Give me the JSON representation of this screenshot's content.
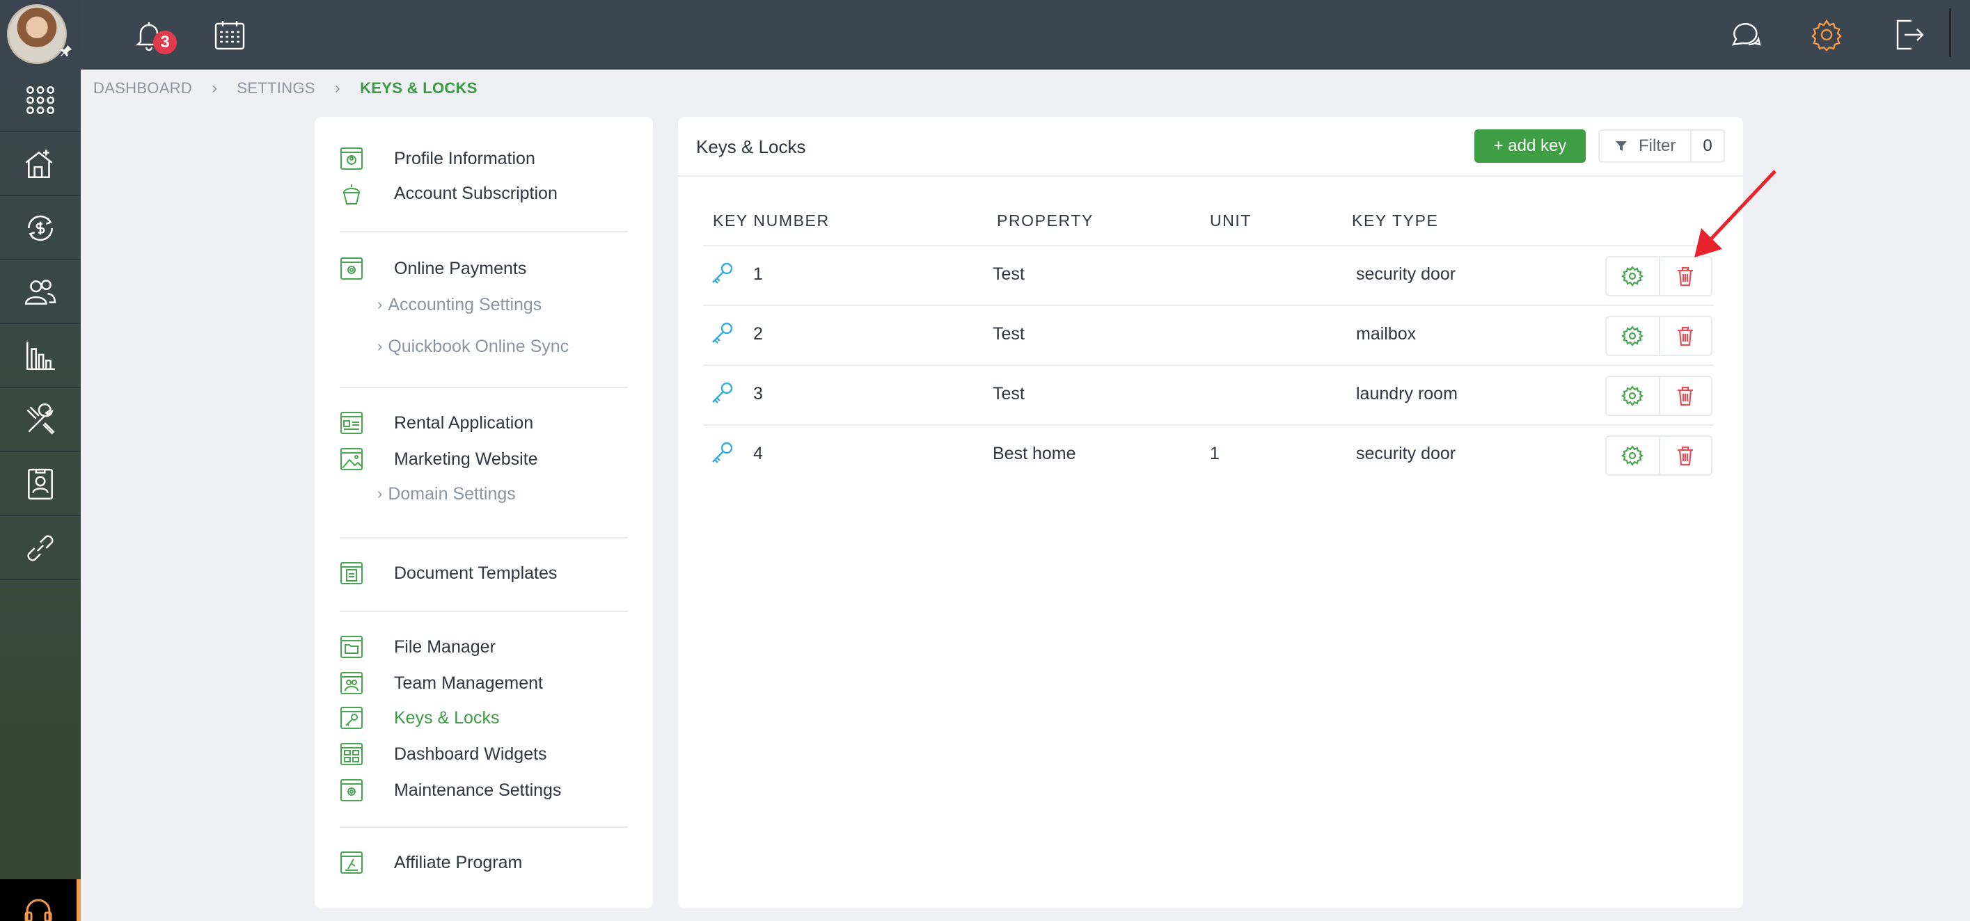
{
  "topbar": {
    "notification_count": "3"
  },
  "breadcrumb": {
    "items": [
      "DASHBOARD",
      "SETTINGS",
      "KEYS & LOCKS"
    ],
    "separator": "›"
  },
  "menu": {
    "profile_information": "Profile Information",
    "account_subscription": "Account Subscription",
    "online_payments": "Online Payments",
    "accounting_settings": "Accounting Settings",
    "quickbook_online_sync": "Quickbook Online Sync",
    "rental_application": "Rental Application",
    "marketing_website": "Marketing Website",
    "domain_settings": "Domain Settings",
    "document_templates": "Document Templates",
    "file_manager": "File Manager",
    "team_management": "Team Management",
    "keys_locks": "Keys & Locks",
    "dashboard_widgets": "Dashboard Widgets",
    "maintenance_settings": "Maintenance Settings",
    "affiliate_program": "Affiliate Program",
    "sub_chevron": "›"
  },
  "card": {
    "title": "Keys & Locks",
    "add_key_label": "+ add key",
    "filter_label": "Filter",
    "filter_count": "0"
  },
  "table": {
    "headers": [
      "KEY NUMBER",
      "PROPERTY",
      "UNIT",
      "KEY TYPE"
    ],
    "rows": [
      {
        "number": "1",
        "property": "Test",
        "unit": "",
        "key_type": "security door"
      },
      {
        "number": "2",
        "property": "Test",
        "unit": "",
        "key_type": "mailbox"
      },
      {
        "number": "3",
        "property": "Test",
        "unit": "",
        "key_type": "laundry room"
      },
      {
        "number": "4",
        "property": "Best home",
        "unit": "1",
        "key_type": "security door"
      }
    ]
  },
  "colors": {
    "accent_green": "#3d9e44",
    "key_icon_blue": "#36aadb",
    "delete_red": "#e0505a",
    "settings_orange": "#f2994a",
    "annotation_arrow": "#e8232d"
  },
  "icons": {
    "rail": [
      "apps-grid-icon",
      "house-icon",
      "money-cycle-icon",
      "users-icon",
      "chart-icon",
      "tools-icon",
      "contact-card-icon",
      "link-icon",
      "headset-icon"
    ],
    "topbar": [
      "bell-icon",
      "calendar-icon",
      "chat-icon",
      "gear-icon",
      "logout-icon"
    ]
  }
}
